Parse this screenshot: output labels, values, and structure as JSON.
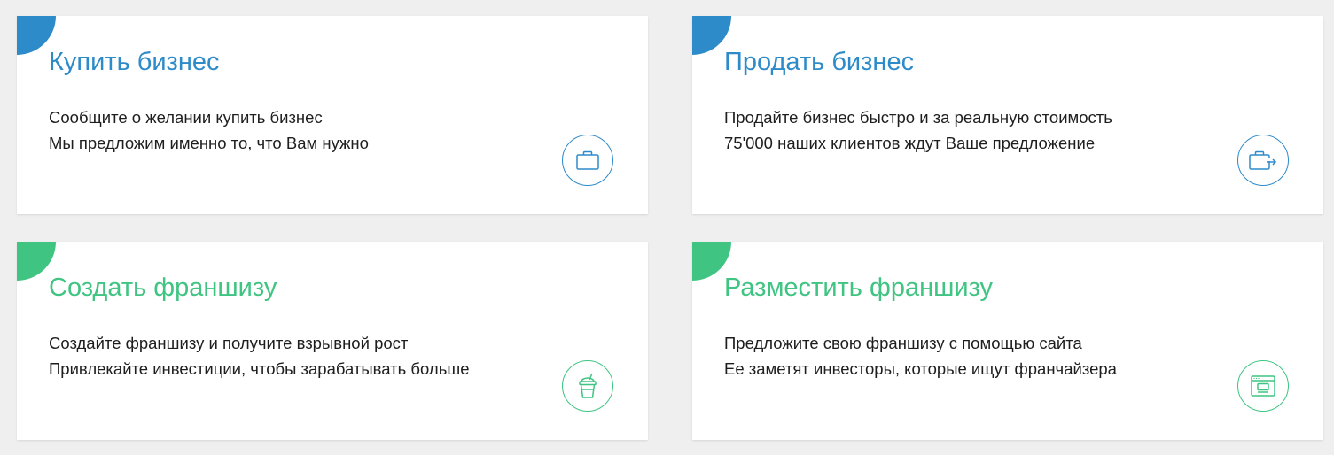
{
  "colors": {
    "blue": "#2e8bc9",
    "green": "#3fc482",
    "background": "#efefef",
    "card": "#ffffff",
    "text": "#1e1e1e"
  },
  "cards": [
    {
      "title": "Купить бизнес",
      "line1": "Сообщите о желании купить бизнес",
      "line2": "Мы предложим именно то, что Вам нужно",
      "icon": "briefcase-icon",
      "accent": "blue"
    },
    {
      "title": "Продать бизнес",
      "line1": "Продайте бизнес быстро и за реальную стоимость",
      "line2": "75'000 наших клиентов ждут Ваше предложение",
      "icon": "briefcase-arrow-icon",
      "accent": "blue"
    },
    {
      "title": "Создать франшизу",
      "line1": "Создайте франшизу и получите взрывной рост",
      "line2": "Привлекайте инвестиции, чтобы зарабатывать больше",
      "icon": "drink-cup-icon",
      "accent": "green"
    },
    {
      "title": "Разместить франшизу",
      "line1": "Предложите свою франшизу с помощью сайта",
      "line2": "Ее заметят инвесторы, которые ищут франчайзера",
      "icon": "website-icon",
      "accent": "green"
    }
  ]
}
